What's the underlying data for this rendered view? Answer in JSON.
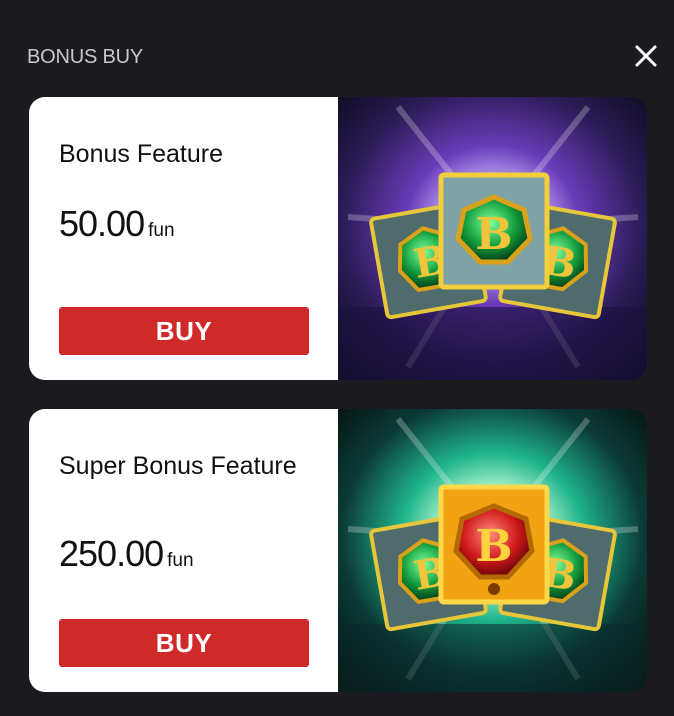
{
  "header": {
    "title": "BONUS BUY",
    "close_icon": "close-icon"
  },
  "cards": [
    {
      "name": "Bonus Feature",
      "price": "50.00",
      "unit": "fun",
      "buy_label": "BUY",
      "art": {
        "center_card_color": "#7fa3a7",
        "glow": "#b36cff"
      }
    },
    {
      "name": "Super Bonus Feature",
      "price": "250.00",
      "unit": "fun",
      "buy_label": "BUY",
      "art": {
        "center_card_color": "#f2a311",
        "glow": "#31e3b5"
      }
    }
  ],
  "colors": {
    "background": "#1b1a1f",
    "buy_button": "#cf2b2b",
    "card": "#ffffff"
  }
}
